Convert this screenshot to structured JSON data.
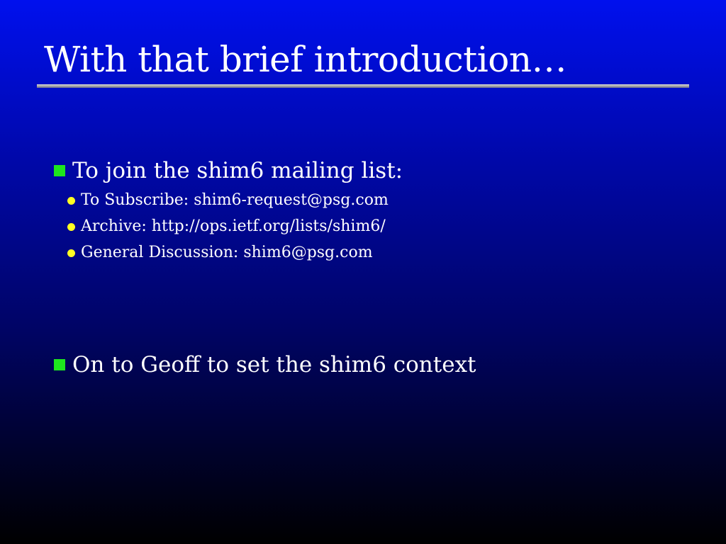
{
  "slide": {
    "title": "With that brief introduction…",
    "bullets": [
      {
        "text": "To join the shim6 mailing list:",
        "subitems": [
          "To Subscribe: shim6-request@psg.com",
          "Archive: http://ops.ietf.org/lists/shim6/",
          "General Discussion: shim6@psg.com"
        ]
      },
      {
        "text": "On to Geoff to set the shim6 context"
      }
    ]
  },
  "colors": {
    "background_top": "#0010ee",
    "background_bottom": "#000000",
    "level1_bullet": "#1ee61e",
    "level2_bullet": "#ffff22",
    "text": "#ffffff"
  },
  "icons": {
    "level1_bullet": "green-square-bullet-icon",
    "level2_bullet": "yellow-dot-bullet-icon"
  }
}
